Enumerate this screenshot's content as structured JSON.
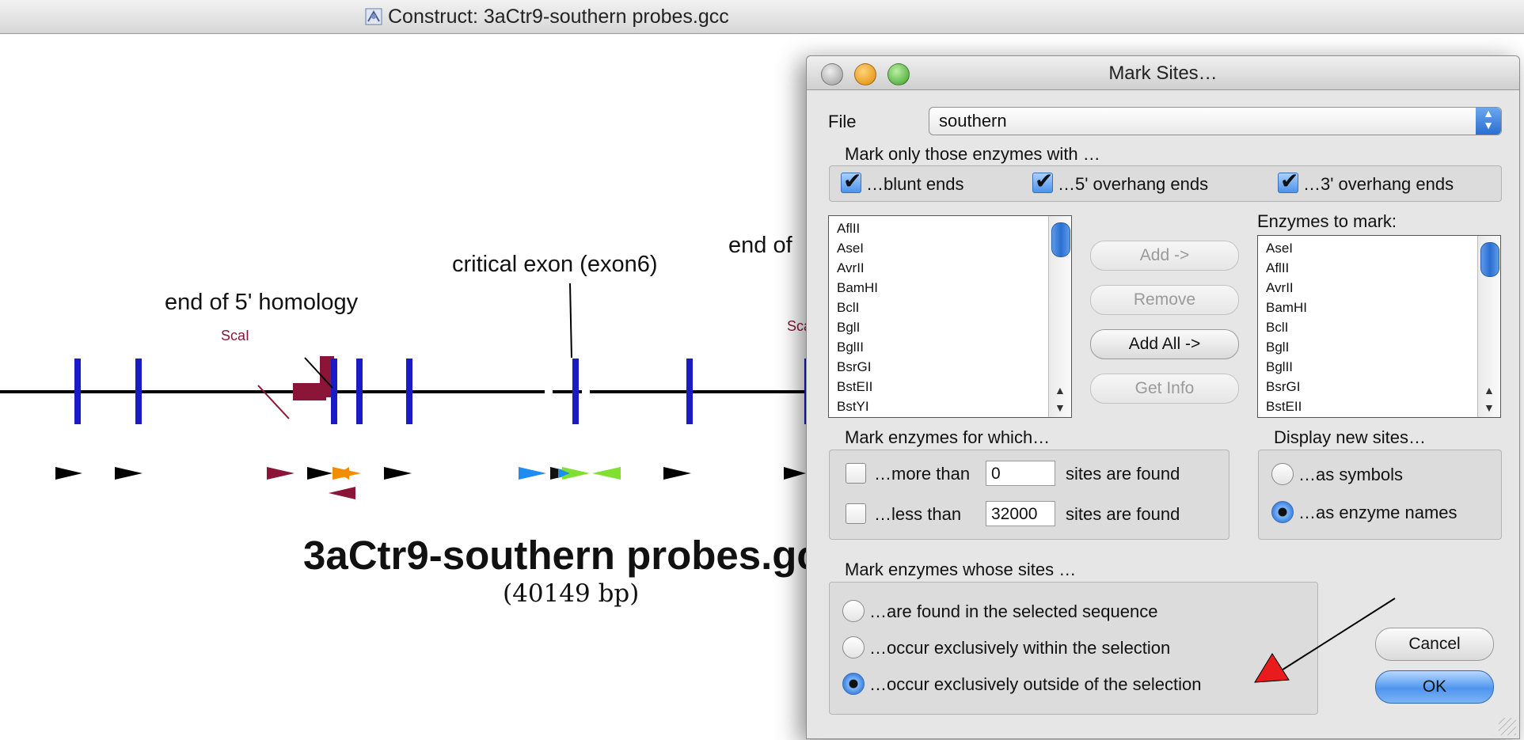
{
  "window": {
    "title": "Construct:  3aCtr9-southern probes.gcc",
    "icon": "construct-document-icon"
  },
  "map": {
    "labels": {
      "homology": "end of 5' homology",
      "exon": "critical exon (exon6)",
      "end_partial": "end of",
      "scal1": "ScaI",
      "scal2": "Sca"
    },
    "title": "3aCtr9-southern probes.gc",
    "size": "(40149 bp)",
    "colors": {
      "backbone": "#000000",
      "site": "#1a1ac8",
      "feature": "#8a1538",
      "orange": "#f28c00",
      "blue": "#1e8cf0",
      "green": "#7fe030"
    }
  },
  "dialog": {
    "title": "Mark Sites…",
    "file_label": "File",
    "file_value": "southern",
    "ends_group_title": "Mark only those enzymes with …",
    "blunt_label": "…blunt ends",
    "blunt_checked": true,
    "five_label": "…5' overhang ends",
    "five_checked": true,
    "three_label": "…3' overhang ends",
    "three_checked": true,
    "available": [
      "AflII",
      "AseI",
      "AvrII",
      "BamHI",
      "BclI",
      "BglI",
      "BglII",
      "BsrGI",
      "BstEII",
      "BstYI"
    ],
    "enzymes_to_mark_label": "Enzymes to mark:",
    "selected": [
      "AseI",
      "AflII",
      "AvrII",
      "BamHI",
      "BclI",
      "BglI",
      "BglII",
      "BsrGI",
      "BstEII"
    ],
    "buttons": {
      "add": "Add ->",
      "remove": "Remove",
      "add_all": "Add All ->",
      "get_info": "Get Info",
      "cancel": "Cancel",
      "ok": "OK"
    },
    "count_group_title": "Mark enzymes for which…",
    "more_than_label": "…more than",
    "more_than_value": "0",
    "less_than_label": "…less than",
    "less_than_value": "32000",
    "sites_found": "sites are found",
    "display_group_title": "Display new sites…",
    "as_symbols": "…as symbols",
    "as_names": "…as enzyme names",
    "whose_group_title": "Mark enzymes whose sites …",
    "opt_found": "…are found in the selected sequence",
    "opt_within": "…occur exclusively within the selection",
    "opt_outside": "…occur exclusively outside of the selection"
  },
  "annotation": {
    "arrow_color": "#e81c1c"
  }
}
